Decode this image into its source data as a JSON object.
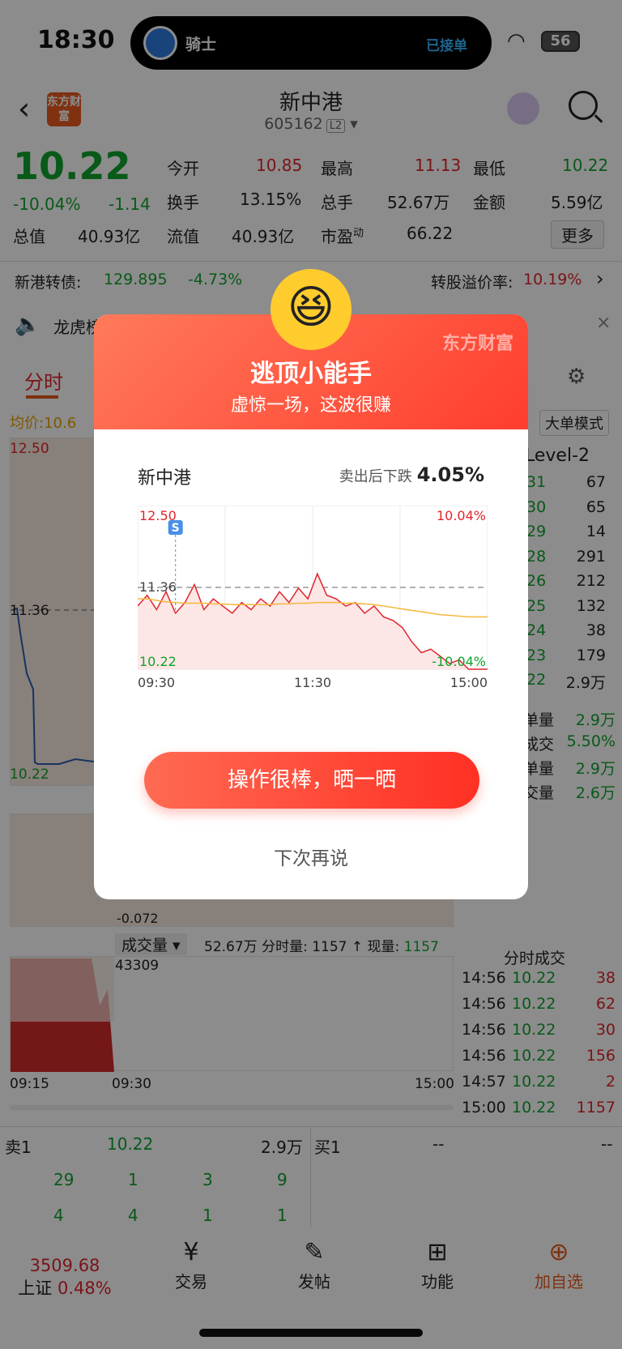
{
  "status": {
    "time": "18:30",
    "island_name": "骑士",
    "island_status": "已接单",
    "battery": "56"
  },
  "header": {
    "logo": "东方财富",
    "title": "新中港",
    "code": "605162",
    "level": "L2"
  },
  "quote": {
    "price": "10.22",
    "pct": "-10.04%",
    "chg": "-1.14",
    "open_label": "今开",
    "open": "10.85",
    "high_label": "最高",
    "high": "11.13",
    "low_label": "最低",
    "low": "10.22",
    "turn_label": "换手",
    "turn": "13.15%",
    "vol_label": "总手",
    "vol": "52.67万",
    "amt_label": "金额",
    "amt": "5.59亿",
    "cap_label": "总值",
    "cap": "40.93亿",
    "float_label": "流值",
    "float": "40.93亿",
    "pe_label": "市盈",
    "pe_sup": "动",
    "pe": "66.22",
    "more": "更多"
  },
  "bond": {
    "name": "新港转债:",
    "price": "129.895",
    "pct": "-4.73%",
    "prem_label": "转股溢价率:",
    "prem": "10.19%"
  },
  "notice": {
    "text": "龙虎榜…"
  },
  "tabs": {
    "active": "分时",
    "mode": "大单模式"
  },
  "left_chart": {
    "avg_label": "均价:",
    "avg": "10.6",
    "high": "12.50",
    "mid": "11.36",
    "low": "10.22",
    "ind": "-0.072"
  },
  "orderbook": {
    "title": "Level-2",
    "rows": [
      [
        "31",
        "67"
      ],
      [
        "30",
        "65"
      ],
      [
        "29",
        "14"
      ],
      [
        "28",
        "291"
      ],
      [
        "26",
        "212"
      ],
      [
        "25",
        "132"
      ],
      [
        "24",
        "38"
      ],
      [
        "23",
        "179"
      ],
      [
        "22",
        "2.9万"
      ]
    ],
    "stats": [
      [
        "单量",
        "2.9万"
      ],
      [
        "成交",
        "5.50%"
      ],
      [
        "单量",
        "2.9万"
      ],
      [
        "交量",
        "2.6万"
      ]
    ]
  },
  "volume": {
    "label": "成交量",
    "info": "52.67万 分时量: 1157 ↑ 现量:",
    "now": "1157",
    "peak": "43309",
    "t1": "09:15",
    "t2": "09:30",
    "t3": "15:00"
  },
  "ticks": {
    "title": "分时成交",
    "rows": [
      [
        "14:56",
        "10.22",
        "38"
      ],
      [
        "14:56",
        "10.22",
        "62"
      ],
      [
        "14:56",
        "10.22",
        "30"
      ],
      [
        "14:56",
        "10.22",
        "156"
      ],
      [
        "14:57",
        "10.22",
        "2"
      ],
      [
        "15:00",
        "10.22",
        "1157"
      ]
    ]
  },
  "book": {
    "sell1_label": "卖1",
    "sell1_price": "10.22",
    "sell1_vol": "2.9万",
    "buy1_label": "买1",
    "buy1_price": "--",
    "buy1_vol": "--",
    "row1": [
      "29",
      "1",
      "3",
      "9"
    ],
    "row2": [
      "4",
      "4",
      "1",
      "1"
    ]
  },
  "nav": {
    "index_val": "3509.68",
    "index_name": "上证",
    "index_pct": "0.48%",
    "trade": "交易",
    "post": "发帖",
    "func": "功能",
    "add": "加自选"
  },
  "modal": {
    "title": "逃顶小能手",
    "subtitle": "虚惊一场，这波很赚",
    "watermark": "东方财富",
    "stock": "新中港",
    "drop_label": "卖出后下跌",
    "drop": "4.05%",
    "btn": "操作很棒，晒一晒",
    "later": "下次再说"
  },
  "chart_data": {
    "type": "line",
    "title": "",
    "y_top": "12.50",
    "y_mid": "11.36",
    "y_bottom": "10.22",
    "pct_top": "10.04%",
    "pct_bottom": "-10.04%",
    "x": [
      "09:30",
      "11:30",
      "15:00"
    ],
    "ylim": [
      10.22,
      12.5
    ],
    "series": [
      {
        "values": [
          11.1,
          11.25,
          11.05,
          11.3,
          11.0,
          11.15,
          11.4,
          11.05,
          11.2,
          11.1,
          11.0,
          11.15,
          11.05,
          11.2,
          11.1,
          11.3,
          11.15,
          11.35,
          11.2,
          11.55,
          11.25,
          11.2,
          11.1,
          11.15,
          11.0,
          11.1,
          10.95,
          10.9,
          10.8,
          10.6,
          10.45,
          10.5,
          10.4,
          10.3,
          10.35,
          10.22,
          10.22,
          10.22
        ]
      },
      {
        "values": [
          11.2,
          11.2,
          11.18,
          11.16,
          11.15,
          11.14,
          11.14,
          11.14,
          11.13,
          11.13,
          11.12,
          11.12,
          11.12,
          11.12,
          11.12,
          11.13,
          11.13,
          11.14,
          11.14,
          11.15,
          11.15,
          11.15,
          11.14,
          11.14,
          11.13,
          11.12,
          11.1,
          11.08,
          11.06,
          11.04,
          11.02,
          11.0,
          10.98,
          10.97,
          10.96,
          10.95,
          10.95,
          10.95
        ]
      }
    ],
    "sell_marker": "S"
  }
}
